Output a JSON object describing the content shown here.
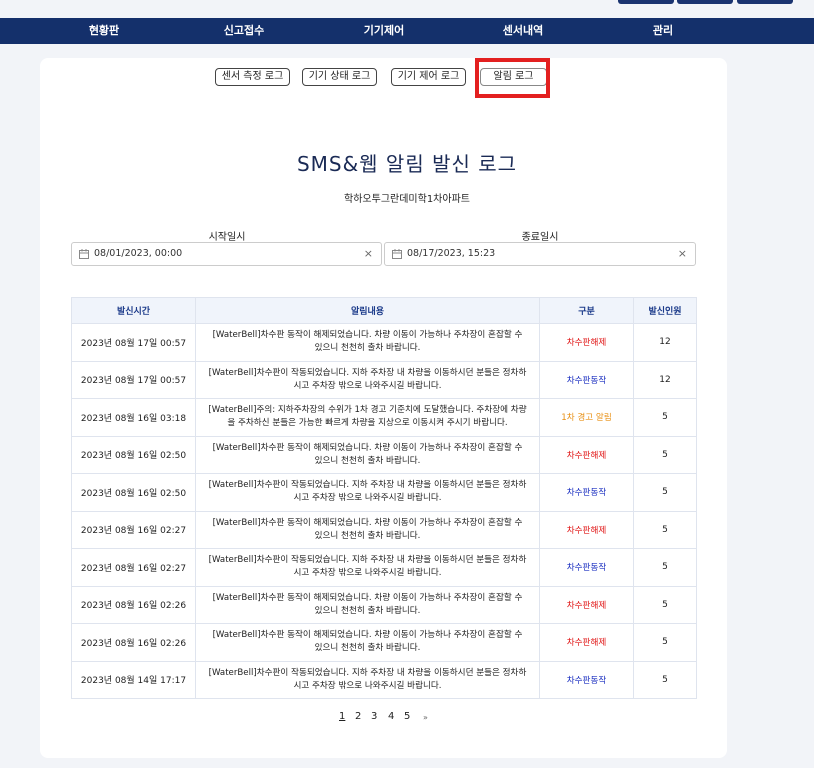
{
  "nav": {
    "items": [
      "현황판",
      "신고접수",
      "기기제어",
      "센서내역",
      "관리"
    ]
  },
  "subtabs": [
    "센서 측정 로그",
    "기기 상태 로그",
    "기기 제어 로그",
    "알림 로그"
  ],
  "page": {
    "title": "SMS&웹 알림 발신 로그",
    "subtitle": "학하오투그란데미학1차아파트"
  },
  "filters": {
    "start_label": "시작일시",
    "start_value": "08/01/2023, 00:00",
    "end_label": "종료일시",
    "end_value": "08/17/2023, 15:23",
    "clear_glyph": "×"
  },
  "table": {
    "headers": [
      "발신시간",
      "알림내용",
      "구분",
      "발신인원"
    ],
    "rows": [
      {
        "time": "2023년 08월 17일 00:57",
        "msg1": "[WaterBell]차수판 동작이 해제되었습니다. 차량 이동이 가능하나 주차장이 혼잡할 수",
        "msg2": "있으니 천천히 출차 바랍니다.",
        "type": "차수판해제",
        "count": "12"
      },
      {
        "time": "2023년 08월 17일 00:57",
        "msg1": "[WaterBell]차수판이 작동되었습니다. 지하 주차장 내 차량을 이동하시던 분들은 정차하",
        "msg2": "시고 주차장 밖으로 나와주시길 바랍니다.",
        "type": "차수판동작",
        "count": "12"
      },
      {
        "time": "2023년 08월 16일 03:18",
        "msg1": "[WaterBell]주의: 지하주차장의 수위가 1차 경고 기준치에 도달했습니다. 주차장에 차량",
        "msg2": "을 주차하신 분들은 가능한 빠르게 차량을 지상으로 이동시켜 주시기 바랍니다.",
        "type": "1차 경고 알림",
        "count": "5"
      },
      {
        "time": "2023년 08월 16일 02:50",
        "msg1": "[WaterBell]차수판 동작이 해제되었습니다. 차량 이동이 가능하나 주차장이 혼잡할 수",
        "msg2": "있으니 천천히 출차 바랍니다.",
        "type": "차수판해제",
        "count": "5"
      },
      {
        "time": "2023년 08월 16일 02:50",
        "msg1": "[WaterBell]차수판이 작동되었습니다. 지하 주차장 내 차량을 이동하시던 분들은 정차하",
        "msg2": "시고 주차장 밖으로 나와주시길 바랍니다.",
        "type": "차수판동작",
        "count": "5"
      },
      {
        "time": "2023년 08월 16일 02:27",
        "msg1": "[WaterBell]차수판 동작이 해제되었습니다. 차량 이동이 가능하나 주차장이 혼잡할 수",
        "msg2": "있으니 천천히 출차 바랍니다.",
        "type": "차수판해제",
        "count": "5"
      },
      {
        "time": "2023년 08월 16일 02:27",
        "msg1": "[WaterBell]차수판이 작동되었습니다. 지하 주차장 내 차량을 이동하시던 분들은 정차하",
        "msg2": "시고 주차장 밖으로 나와주시길 바랍니다.",
        "type": "차수판동작",
        "count": "5"
      },
      {
        "time": "2023년 08월 16일 02:26",
        "msg1": "[WaterBell]차수판 동작이 해제되었습니다. 차량 이동이 가능하나 주차장이 혼잡할 수",
        "msg2": "있으니 천천히 출차 바랍니다.",
        "type": "차수판해제",
        "count": "5"
      },
      {
        "time": "2023년 08월 16일 02:26",
        "msg1": "[WaterBell]차수판 동작이 해제되었습니다. 차량 이동이 가능하나 주차장이 혼잡할 수",
        "msg2": "있으니 천천히 출차 바랍니다.",
        "type": "차수판해제",
        "count": "5"
      },
      {
        "time": "2023년 08월 14일 17:17",
        "msg1": "[WaterBell]차수판이 작동되었습니다. 지하 주차장 내 차량을 이동하시던 분들은 정차하",
        "msg2": "시고 주차장 밖으로 나와주시길 바랍니다.",
        "type": "차수판동작",
        "count": "5"
      }
    ]
  },
  "type_colors": {
    "차수판해제": "#e01515",
    "차수판동작": "#1a2ec0",
    "1차 경고 알림": "#e89014"
  },
  "pagination": {
    "pages": [
      "1",
      "2",
      "3",
      "4",
      "5"
    ],
    "current": "1",
    "next": "»"
  }
}
